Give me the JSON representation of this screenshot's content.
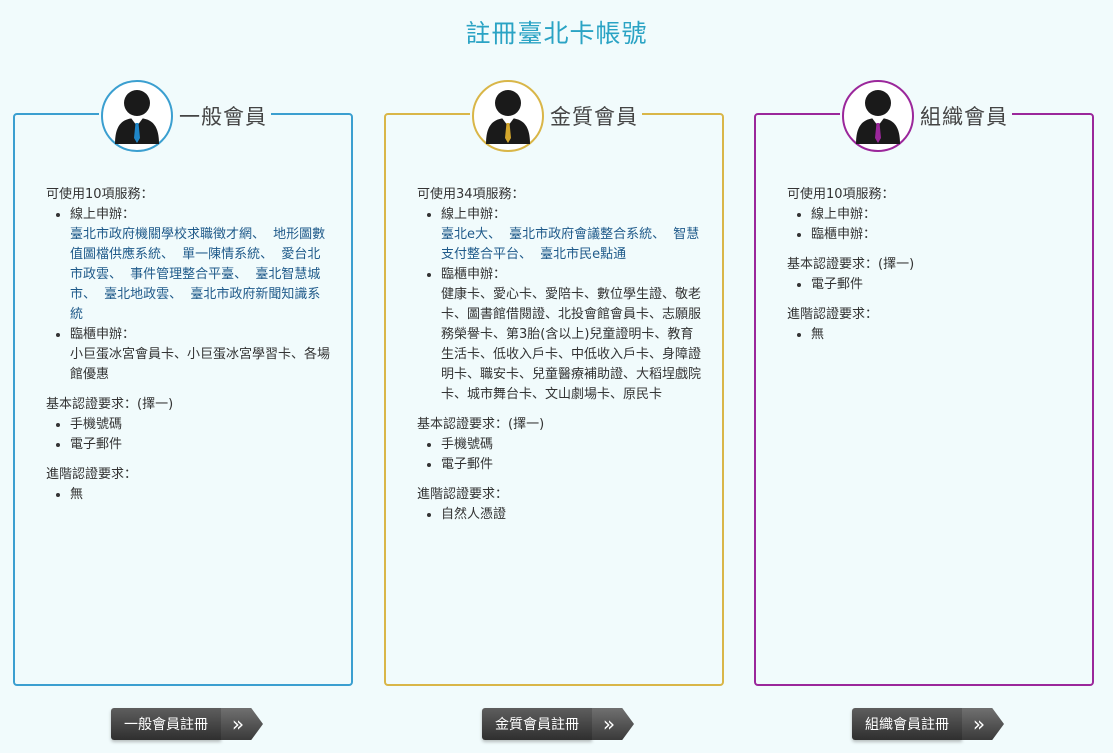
{
  "page": {
    "title": "註冊臺北卡帳號"
  },
  "cards": [
    {
      "title": "一般會員",
      "tie_color": "#1f86c8",
      "services_heading": "可使用10項服務：",
      "online_label": "線上申辦：",
      "online_links": [
        "臺北市政府機關學校求職徵才網、",
        "地形圖數值圖檔供應系統、",
        "單一陳情系統、",
        "愛台北市政雲、",
        "事件管理整合平臺、",
        "臺北智慧城市、",
        "臺北地政雲、",
        "臺北市政府新聞知識系統"
      ],
      "counter_label": "臨櫃申辦：",
      "counter_text": "小巨蛋冰宮會員卡、小巨蛋冰宮學習卡、各場館優惠",
      "basic_heading": "基本認證要求：(擇一)",
      "basic_items": [
        "手機號碼",
        "電子郵件"
      ],
      "advanced_heading": "進階認證要求：",
      "advanced_items": [
        "無"
      ],
      "button_label": "一般會員註冊"
    },
    {
      "title": "金質會員",
      "tie_color": "#d4a72c",
      "services_heading": "可使用34項服務：",
      "online_label": "線上申辦：",
      "online_links": [
        "臺北e大、",
        "臺北市政府會議整合系統、",
        "智慧支付整合平台、",
        "臺北市民e點通"
      ],
      "counter_label": "臨櫃申辦：",
      "counter_text": "健康卡、愛心卡、愛陪卡、數位學生證、敬老卡、圖書館借閱證、北投會館會員卡、志願服務榮譽卡、第3胎(含以上)兒童證明卡、教育生活卡、低收入戶卡、中低收入戶卡、身障證明卡、職安卡、兒童醫療補助證、大稻埕戲院卡、城市舞台卡、文山劇場卡、原民卡",
      "basic_heading": "基本認證要求：(擇一)",
      "basic_items": [
        "手機號碼",
        "電子郵件"
      ],
      "advanced_heading": "進階認證要求：",
      "advanced_items": [
        "自然人憑證"
      ],
      "button_label": "金質會員註冊"
    },
    {
      "title": "組織會員",
      "tie_color": "#9b279b",
      "services_heading": "可使用10項服務：",
      "online_label": "線上申辦：",
      "counter_label": "臨櫃申辦：",
      "basic_heading": "基本認證要求：(擇一)",
      "basic_items": [
        "電子郵件"
      ],
      "advanced_heading": "進階認證要求：",
      "advanced_items": [
        "無"
      ],
      "button_label": "組織會員註冊"
    }
  ],
  "icons": {
    "avatar": "person-suit-icon",
    "arrow": "double-chevron-right-icon"
  }
}
